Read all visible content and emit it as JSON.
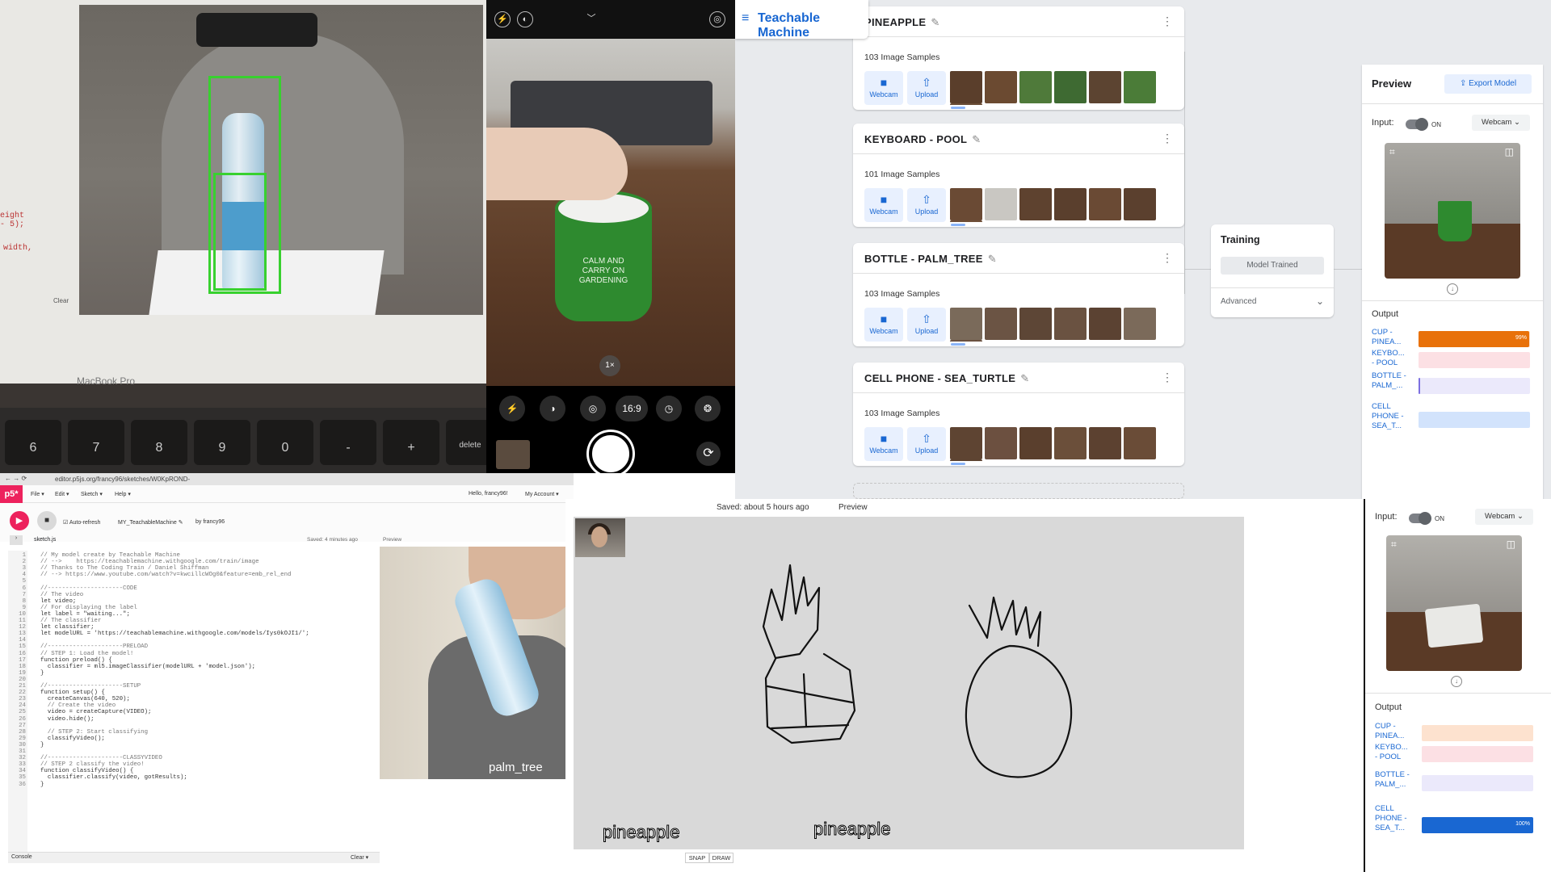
{
  "laptop_photo": {
    "code_line_a": "eight - 5);",
    "code_line_b": "width,",
    "clear_small": "Clear",
    "brand": "MacBook Pro",
    "keys": [
      "6",
      "7",
      "8",
      "9",
      "0",
      "-",
      "+",
      "delete"
    ]
  },
  "phone_camera": {
    "mug_text": "CALM AND CARRY ON GARDENING",
    "zoom": "1×",
    "aspect": "16:9"
  },
  "tm": {
    "app_title": "Teachable Machine",
    "classes": [
      {
        "name": "PINEAPPLE",
        "samples": "103 Image Samples"
      },
      {
        "name": "KEYBOARD - POOL",
        "samples": "101 Image Samples"
      },
      {
        "name": "BOTTLE - PALM_TREE",
        "samples": "103 Image Samples"
      },
      {
        "name": "CELL PHONE - SEA_TURTLE",
        "samples": "103 Image Samples"
      }
    ],
    "webcam_label": "Webcam",
    "upload_label": "Upload",
    "training": {
      "title": "Training",
      "button": "Model Trained",
      "advanced": "Advanced"
    },
    "preview": {
      "title": "Preview",
      "export": "Export Model",
      "input_label": "Input:",
      "on": "ON",
      "source": "Webcam",
      "output_label": "Output",
      "outputs": [
        {
          "label": "CUP - PINEA...",
          "fraction": 0.99,
          "pct": "99%",
          "fill": "#e8710a",
          "track": "#fde2cf"
        },
        {
          "label": "KEYBO... - POOL",
          "fraction": 0.0,
          "pct": "",
          "fill": "#e06071",
          "track": "#fce0e4"
        },
        {
          "label": "BOTTLE - PALM_...",
          "fraction": 0.01,
          "pct": "",
          "fill": "#7c6fe0",
          "track": "#ebe9fb"
        },
        {
          "label": "CELL PHONE - SEA_T...",
          "fraction": 0.0,
          "pct": "",
          "fill": "#1967d2",
          "track": "#d2e3fc"
        }
      ]
    },
    "preview2": {
      "input_label": "Input:",
      "on": "ON",
      "source": "Webcam",
      "output_label": "Output",
      "outputs": [
        {
          "label": "CUP - PINEA...",
          "fraction": 0.0,
          "pct": "",
          "fill": "#e8710a",
          "track": "#fde2cf"
        },
        {
          "label": "KEYBO... - POOL",
          "fraction": 0.0,
          "pct": "",
          "fill": "#e06071",
          "track": "#fce0e4"
        },
        {
          "label": "BOTTLE - PALM_...",
          "fraction": 0.0,
          "pct": "",
          "fill": "#7c6fe0",
          "track": "#ebe9fb"
        },
        {
          "label": "CELL PHONE - SEA_T...",
          "fraction": 1.0,
          "pct": "100%",
          "fill": "#1967d2",
          "track": "#d2e3fc"
        }
      ]
    }
  },
  "p5": {
    "url": "editor.p5js.org/francy96/sketches/W0KpROND-",
    "logo": "p5*",
    "menu": [
      "File ▾",
      "Edit ▾",
      "Sketch ▾",
      "Help ▾"
    ],
    "user": "Hello, francy96!",
    "account": "My Account ▾",
    "auto_refresh": "Auto-refresh",
    "sketch_name": "MY_TeachableMachine ✎",
    "author": "by francy96",
    "file": "sketch.js",
    "saved": "Saved: 4 minutes ago",
    "preview_label": "Preview",
    "console": "Console",
    "clear": "Clear ▾",
    "result_label": "palm_tree",
    "code": [
      "// My model create by Teachable Machine",
      "// -->    https://teachablemachine.withgoogle.com/train/image",
      "// Thanks to The Coding Train / Daniel Shiffman",
      "// --> https://www.youtube.com/watch?v=kwcillcWOg0&feature=emb_rel_end",
      "",
      "//---------------------CODE",
      "// The video",
      "let video;",
      "// For displaying the label",
      "let label = \"waiting...\";",
      "// The classifier",
      "let classifier;",
      "let modelURL = 'https://teachablemachine.withgoogle.com/models/Iys0kOJI1/';",
      "",
      "//---------------------PRELOAD",
      "// STEP 1: Load the model!",
      "function preload() {",
      "  classifier = ml5.imageClassifier(modelURL + 'model.json');",
      "}",
      "",
      "//---------------------SETUP",
      "function setup() {",
      "  createCanvas(640, 520);",
      "  // Create the video",
      "  video = createCapture(VIDEO);",
      "  video.hide();",
      "",
      "  // STEP 2: Start classifying",
      "  classifyVideo();",
      "}",
      "",
      "//---------------------CLASSYVIDEO",
      "// STEP 2 classify the video!",
      "function classifyVideo() {",
      "  classifier.classify(video, gotResults);",
      "}"
    ]
  },
  "drawing": {
    "saved": "Saved: about 5 hours ago",
    "preview": "Preview",
    "caption_left": "pineapple",
    "caption_right": "pineapple",
    "tabs": [
      "SNAP",
      "DRAW"
    ]
  }
}
